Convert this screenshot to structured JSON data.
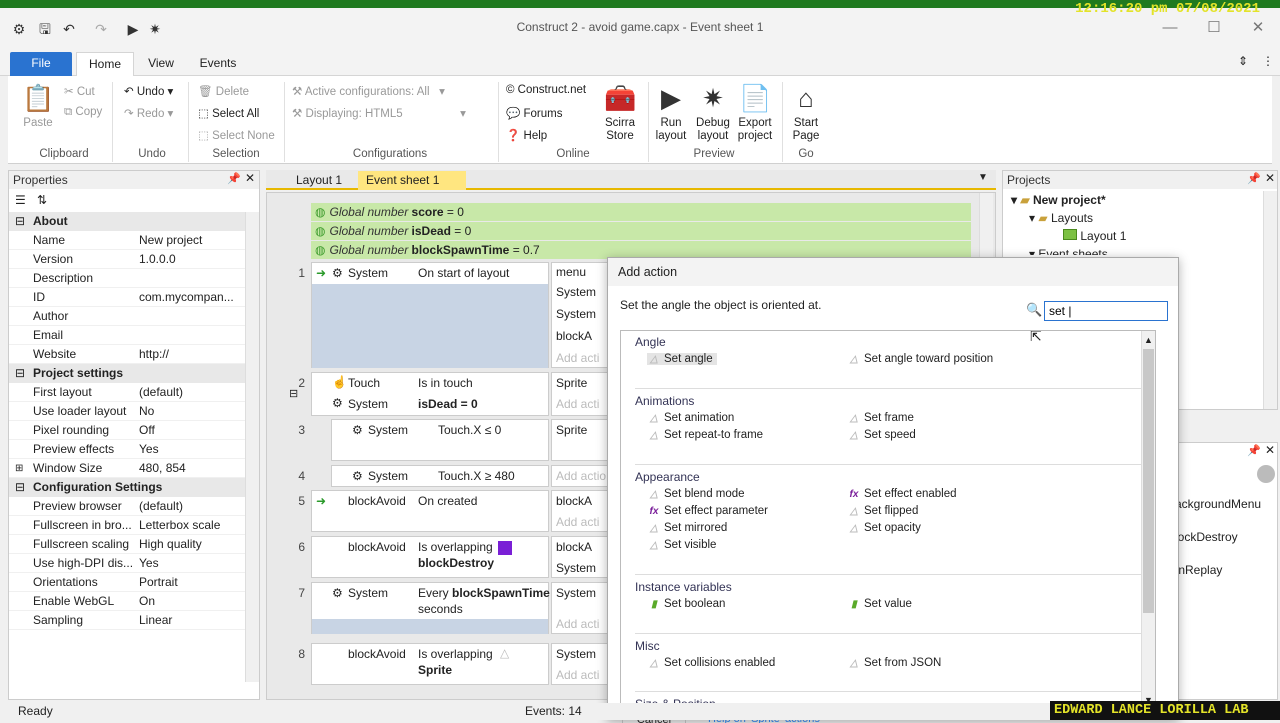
{
  "window": {
    "title": "Construct 2 - avoid game.capx - Event sheet 1",
    "clock": "12:16:20 pm 07/08/2021",
    "minimize": "—",
    "maximize": "☐",
    "close": "✕"
  },
  "ribbon": {
    "tabs": [
      "File",
      "Home",
      "View",
      "Events"
    ],
    "clipboard": {
      "paste": "Paste",
      "cut": "Cut",
      "copy": "Copy",
      "label": "Clipboard"
    },
    "undo": {
      "undo": "Undo",
      "redo": "Redo",
      "label": "Undo"
    },
    "selection": {
      "delete": "Delete",
      "select_all": "Select All",
      "select_none": "Select None",
      "label": "Selection"
    },
    "configurations": {
      "active": "Active configurations: All",
      "displaying_label": "Displaying:",
      "displaying_value": "HTML5",
      "label": "Configurations"
    },
    "online": {
      "construct_net": "Construct.net",
      "forums": "Forums",
      "help": "Help",
      "label": "Online"
    },
    "store": {
      "line1": "Scirra",
      "line2": "Store"
    },
    "preview": {
      "run": [
        "Run",
        "layout"
      ],
      "debug": [
        "Debug",
        "layout"
      ],
      "export": [
        "Export",
        "project"
      ],
      "label": "Preview"
    },
    "go": {
      "start": [
        "Start",
        "Page"
      ],
      "label": "Go"
    }
  },
  "properties": {
    "title": "Properties",
    "rows": [
      {
        "type": "cat",
        "label": "About"
      },
      {
        "k": "Name",
        "v": "New project"
      },
      {
        "k": "Version",
        "v": "1.0.0.0"
      },
      {
        "k": "Description",
        "v": ""
      },
      {
        "k": "ID",
        "v": "com.mycompan..."
      },
      {
        "k": "Author",
        "v": ""
      },
      {
        "k": "Email",
        "v": ""
      },
      {
        "k": "Website",
        "v": "http://"
      },
      {
        "type": "cat",
        "label": "Project settings"
      },
      {
        "k": "First layout",
        "v": "(default)"
      },
      {
        "k": "Use loader layout",
        "v": "No"
      },
      {
        "k": "Pixel rounding",
        "v": "Off"
      },
      {
        "k": "Preview effects",
        "v": "Yes"
      },
      {
        "k": "Window Size",
        "v": "480, 854"
      },
      {
        "type": "cat",
        "label": "Configuration Settings"
      },
      {
        "k": "Preview browser",
        "v": "(default)"
      },
      {
        "k": "Fullscreen in bro...",
        "v": "Letterbox scale"
      },
      {
        "k": "Fullscreen scaling",
        "v": "High quality"
      },
      {
        "k": "Use high-DPI dis...",
        "v": "Yes"
      },
      {
        "k": "Orientations",
        "v": "Portrait"
      },
      {
        "k": "Enable WebGL",
        "v": "On"
      },
      {
        "k": "Sampling",
        "v": "Linear"
      }
    ]
  },
  "sheet": {
    "tabs": [
      "Layout 1",
      "Event sheet 1"
    ],
    "globals": [
      {
        "kw": "Global number",
        "name": "score",
        "val": "= 0"
      },
      {
        "kw": "Global number",
        "name": "isDead",
        "val": "= 0"
      },
      {
        "kw": "Global number",
        "name": "blockSpawnTime",
        "val": "= 0.7"
      }
    ],
    "events": {
      "e1": {
        "num": "1",
        "obj": "System",
        "cond": "On start of layout",
        "acts": [
          "menu",
          "System",
          "System",
          "blockA",
          "Add acti"
        ]
      },
      "e2": {
        "num": "2",
        "obj1": "Touch",
        "cond1": "Is in touch",
        "obj2": "System",
        "cond2": "isDead = 0",
        "acts": [
          "Sprite",
          "Add acti"
        ]
      },
      "e3": {
        "num": "3",
        "obj": "System",
        "cond": "Touch.X ≤ 0",
        "acts": [
          "Sprite"
        ]
      },
      "e4": {
        "num": "4",
        "obj": "System",
        "cond": "Touch.X ≥ 480",
        "acts": [
          "Add actio"
        ]
      },
      "e5": {
        "num": "5",
        "obj": "blockAvoid",
        "cond": "On created",
        "acts": [
          "blockA",
          "Add acti"
        ]
      },
      "e6": {
        "num": "6",
        "obj": "blockAvoid",
        "cond1": "Is overlapping",
        "cond2": "blockDestroy",
        "acts": [
          "blockA",
          "System"
        ]
      },
      "e7": {
        "num": "7",
        "obj": "System",
        "cond1": "Every",
        "cond_bold": "blockSpawnTime",
        "cond2": "seconds",
        "acts": [
          "System",
          "Add acti"
        ]
      },
      "e8": {
        "num": "8",
        "obj": "blockAvoid",
        "cond1": "Is overlapping",
        "cond2": "Sprite",
        "acts": [
          "System",
          "Add acti"
        ]
      }
    }
  },
  "projects": {
    "title": "Projects",
    "root": "New project*",
    "layouts": "Layouts",
    "layout1": "Layout 1",
    "eventsheets": "Event sheets",
    "partial": [
      "ackgroundMenu",
      "lockDestroy",
      "tnReplay"
    ]
  },
  "dialog": {
    "title": "Add action",
    "description": "Set the angle the object is oriented at.",
    "search_value": "set |",
    "categories": [
      {
        "name": "Angle",
        "items": [
          "Set angle",
          "Set angle toward position"
        ]
      },
      {
        "name": "Animations",
        "items": [
          "Set animation",
          "Set frame",
          "Set repeat-to frame",
          "Set speed"
        ]
      },
      {
        "name": "Appearance",
        "items": [
          "Set blend mode",
          "Set effect enabled",
          "Set effect parameter",
          "Set flipped",
          "Set mirrored",
          "Set opacity",
          "Set visible"
        ]
      },
      {
        "name": "Instance variables",
        "items": [
          "Set boolean",
          "Set value"
        ]
      },
      {
        "name": "Misc",
        "items": [
          "Set collisions enabled",
          "Set from JSON"
        ]
      },
      {
        "name": "Size & Position",
        "items": []
      }
    ],
    "cancel": "Cancel",
    "help": "Help on 'Sprite' actions"
  },
  "status": {
    "ready": "Ready",
    "events": "Events: 14"
  },
  "watermark": "EDWARD LANCE LORILLA LAB",
  "colors": {
    "accent": "#2a73d0",
    "global_bg": "#c8e8a8",
    "tab_active": "#ffe680"
  }
}
